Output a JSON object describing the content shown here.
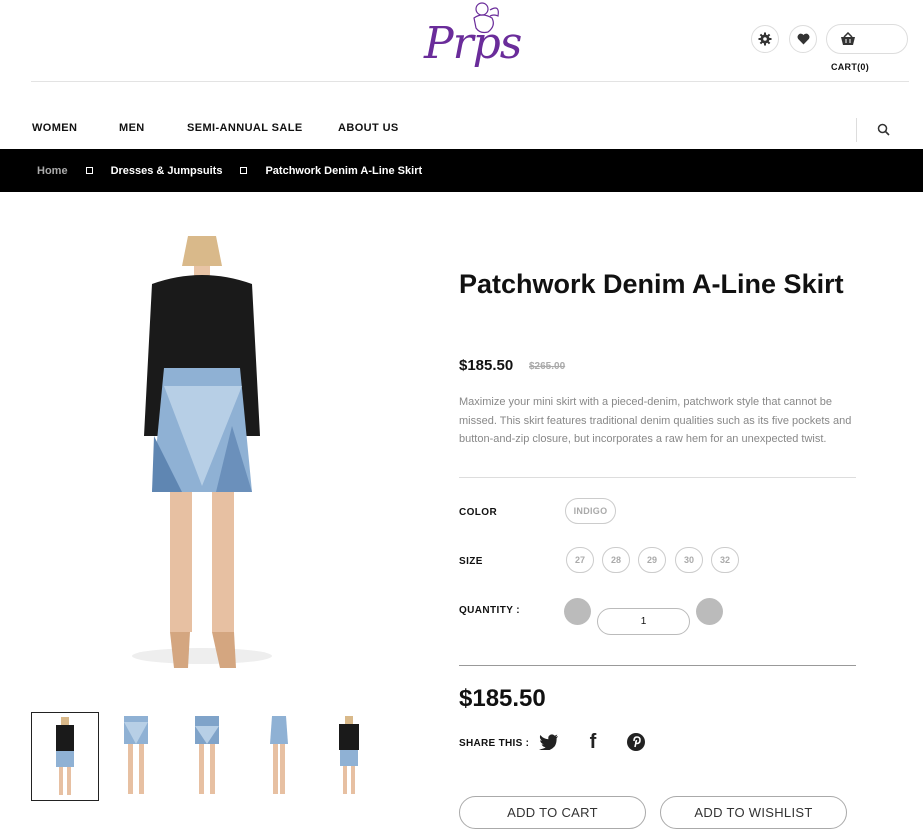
{
  "brand": {
    "logo_text": "Prps"
  },
  "header": {
    "cart_label": "CART(0)",
    "settings_icon": "gear-icon",
    "wishlist_icon": "heart-icon",
    "cart_icon": "basket-icon"
  },
  "nav": {
    "items": [
      "WOMEN",
      "MEN",
      "SEMI-ANNUAL SALE",
      "ABOUT US"
    ],
    "search_icon": "search-icon"
  },
  "breadcrumb": {
    "items": [
      "Home",
      "Dresses & Jumpsuits",
      "Patchwork Denim A-Line Skirt"
    ]
  },
  "product": {
    "title": "Patchwork Denim A-Line Skirt",
    "price": "$185.50",
    "old_price": "$265.00",
    "description": "Maximize your mini skirt with a pieced-denim, patchwork style that cannot be missed. This skirt features traditional denim qualities such as its five pockets and button-and-zip closure, but incorporates a raw hem for an unexpected twist.",
    "color_label": "COLOR",
    "color_value": "INDIGO",
    "size_label": "SIZE",
    "sizes": [
      "27",
      "28",
      "29",
      "30",
      "32"
    ],
    "quantity_label": "QUANTITY :",
    "quantity": "1",
    "total_price": "$185.50",
    "share_label": "SHARE THIS :",
    "share_icons": [
      "twitter-icon",
      "facebook-icon",
      "pinterest-icon"
    ],
    "add_to_cart": "ADD TO CART",
    "add_to_wishlist": "ADD TO WISHLIST"
  },
  "colors": {
    "brand_purple": "#6a2c9a",
    "breadcrumb_bg": "#000000"
  }
}
